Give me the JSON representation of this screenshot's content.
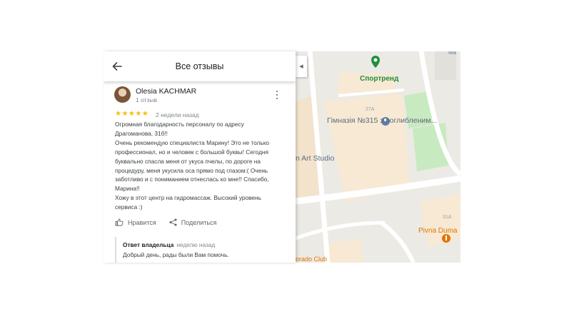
{
  "panel": {
    "title": "Все отзывы",
    "back_icon": "arrow-back-icon"
  },
  "review": {
    "author": "Olesia KACHMAR",
    "author_meta": "1 отзыв",
    "rating": 5,
    "stars": "★★★★★",
    "date": "2 недели назад",
    "text_lines": [
      "Огромная благодарность персоналу по адресу",
      "Драгоманова, 31б!!",
      "Очень рекомендую специалиста Марину! Это не только",
      "профессионал, но и человек с большой буквы! Сегодня",
      "буквально спасла меня от укуса пчелы, по дороге на",
      "процедуру, меня укусила оса прямо под глазом:( Очень",
      "заботливо и с пониманием отнеслась ко мне!! Спасибо,",
      "Марина!!",
      "Хожу в этот центр на гидромассаж. Высокий уровень",
      "сервиса :)"
    ],
    "like_label": "Нравится",
    "share_label": "Поделиться"
  },
  "owner_reply": {
    "label": "Ответ владельца",
    "when": "неделю назад",
    "text": "Добрый день, рады были Вам помочь."
  },
  "map": {
    "labels": {
      "sport": "Спортренд",
      "gym": "Гімназія №315 з поглибленим...",
      "art": "n Art Studio",
      "pivna": "Pivna Duma",
      "bldg_27a": "27А",
      "bldg_31a": "31А",
      "club": "orado Club",
      "top": "Ma"
    },
    "colors": {
      "background": "#eceae4",
      "road": "#ffffff",
      "park": "#c8eac0",
      "building": "#f7e9d4",
      "pin_green": "#1e8e3e",
      "pin_orange": "#e37400",
      "pin_blue": "#5f7fa8"
    }
  }
}
